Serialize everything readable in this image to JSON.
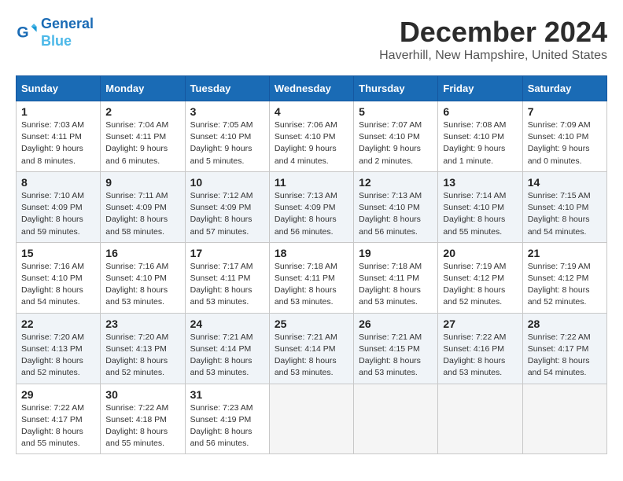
{
  "logo": {
    "line1": "General",
    "line2": "Blue"
  },
  "title": "December 2024",
  "subtitle": "Haverhill, New Hampshire, United States",
  "days_of_week": [
    "Sunday",
    "Monday",
    "Tuesday",
    "Wednesday",
    "Thursday",
    "Friday",
    "Saturday"
  ],
  "weeks": [
    [
      {
        "day": 1,
        "sunrise": "7:03 AM",
        "sunset": "4:11 PM",
        "daylight": "9 hours and 8 minutes."
      },
      {
        "day": 2,
        "sunrise": "7:04 AM",
        "sunset": "4:11 PM",
        "daylight": "9 hours and 6 minutes."
      },
      {
        "day": 3,
        "sunrise": "7:05 AM",
        "sunset": "4:10 PM",
        "daylight": "9 hours and 5 minutes."
      },
      {
        "day": 4,
        "sunrise": "7:06 AM",
        "sunset": "4:10 PM",
        "daylight": "9 hours and 4 minutes."
      },
      {
        "day": 5,
        "sunrise": "7:07 AM",
        "sunset": "4:10 PM",
        "daylight": "9 hours and 2 minutes."
      },
      {
        "day": 6,
        "sunrise": "7:08 AM",
        "sunset": "4:10 PM",
        "daylight": "9 hours and 1 minute."
      },
      {
        "day": 7,
        "sunrise": "7:09 AM",
        "sunset": "4:10 PM",
        "daylight": "9 hours and 0 minutes."
      }
    ],
    [
      {
        "day": 8,
        "sunrise": "7:10 AM",
        "sunset": "4:09 PM",
        "daylight": "8 hours and 59 minutes."
      },
      {
        "day": 9,
        "sunrise": "7:11 AM",
        "sunset": "4:09 PM",
        "daylight": "8 hours and 58 minutes."
      },
      {
        "day": 10,
        "sunrise": "7:12 AM",
        "sunset": "4:09 PM",
        "daylight": "8 hours and 57 minutes."
      },
      {
        "day": 11,
        "sunrise": "7:13 AM",
        "sunset": "4:09 PM",
        "daylight": "8 hours and 56 minutes."
      },
      {
        "day": 12,
        "sunrise": "7:13 AM",
        "sunset": "4:10 PM",
        "daylight": "8 hours and 56 minutes."
      },
      {
        "day": 13,
        "sunrise": "7:14 AM",
        "sunset": "4:10 PM",
        "daylight": "8 hours and 55 minutes."
      },
      {
        "day": 14,
        "sunrise": "7:15 AM",
        "sunset": "4:10 PM",
        "daylight": "8 hours and 54 minutes."
      }
    ],
    [
      {
        "day": 15,
        "sunrise": "7:16 AM",
        "sunset": "4:10 PM",
        "daylight": "8 hours and 54 minutes."
      },
      {
        "day": 16,
        "sunrise": "7:16 AM",
        "sunset": "4:10 PM",
        "daylight": "8 hours and 53 minutes."
      },
      {
        "day": 17,
        "sunrise": "7:17 AM",
        "sunset": "4:11 PM",
        "daylight": "8 hours and 53 minutes."
      },
      {
        "day": 18,
        "sunrise": "7:18 AM",
        "sunset": "4:11 PM",
        "daylight": "8 hours and 53 minutes."
      },
      {
        "day": 19,
        "sunrise": "7:18 AM",
        "sunset": "4:11 PM",
        "daylight": "8 hours and 53 minutes."
      },
      {
        "day": 20,
        "sunrise": "7:19 AM",
        "sunset": "4:12 PM",
        "daylight": "8 hours and 52 minutes."
      },
      {
        "day": 21,
        "sunrise": "7:19 AM",
        "sunset": "4:12 PM",
        "daylight": "8 hours and 52 minutes."
      }
    ],
    [
      {
        "day": 22,
        "sunrise": "7:20 AM",
        "sunset": "4:13 PM",
        "daylight": "8 hours and 52 minutes."
      },
      {
        "day": 23,
        "sunrise": "7:20 AM",
        "sunset": "4:13 PM",
        "daylight": "8 hours and 52 minutes."
      },
      {
        "day": 24,
        "sunrise": "7:21 AM",
        "sunset": "4:14 PM",
        "daylight": "8 hours and 53 minutes."
      },
      {
        "day": 25,
        "sunrise": "7:21 AM",
        "sunset": "4:14 PM",
        "daylight": "8 hours and 53 minutes."
      },
      {
        "day": 26,
        "sunrise": "7:21 AM",
        "sunset": "4:15 PM",
        "daylight": "8 hours and 53 minutes."
      },
      {
        "day": 27,
        "sunrise": "7:22 AM",
        "sunset": "4:16 PM",
        "daylight": "8 hours and 53 minutes."
      },
      {
        "day": 28,
        "sunrise": "7:22 AM",
        "sunset": "4:17 PM",
        "daylight": "8 hours and 54 minutes."
      }
    ],
    [
      {
        "day": 29,
        "sunrise": "7:22 AM",
        "sunset": "4:17 PM",
        "daylight": "8 hours and 55 minutes."
      },
      {
        "day": 30,
        "sunrise": "7:22 AM",
        "sunset": "4:18 PM",
        "daylight": "8 hours and 55 minutes."
      },
      {
        "day": 31,
        "sunrise": "7:23 AM",
        "sunset": "4:19 PM",
        "daylight": "8 hours and 56 minutes."
      },
      null,
      null,
      null,
      null
    ]
  ]
}
